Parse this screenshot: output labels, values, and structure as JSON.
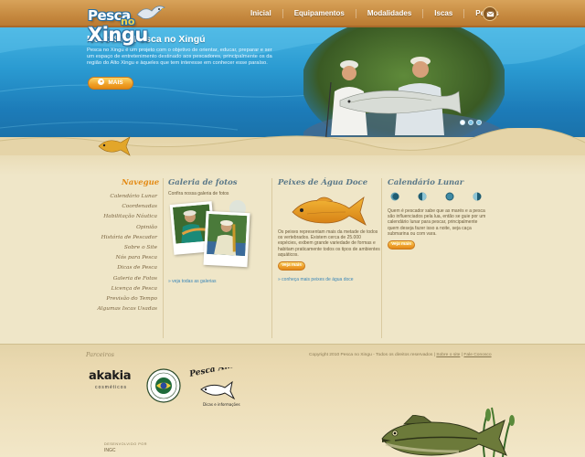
{
  "brand": {
    "logo_line1": "Pesca",
    "logo_line2": "no",
    "logo_line3": "Xingu"
  },
  "nav": {
    "items": [
      "Inicial",
      "Equipamentos",
      "Modalidades",
      "Iscas",
      "Peixes"
    ]
  },
  "hero": {
    "title": "Novo Site Pesca no Xingú",
    "text": "Pesca no Xingu é um projeto com o objetivo de orientar, educar, preparar e ser um espaço de entretenimento destinado aos pescadores, principalmente os da região do Alto Xingu e àqueles que tem interesse em conhecer esse paraíso.",
    "button_label": "MAIS",
    "slides_count": 3,
    "active_slide": 1
  },
  "sidebar": {
    "title": "Navegue",
    "items": [
      "Calendário Lunar",
      "Coordenadas",
      "Habilitação Náutica",
      "Opinião",
      "História de Pescador",
      "Sobre o Site",
      "Nós para Pesca",
      "Dicas de Pesca",
      "Galeria de Fotos",
      "Licença de Pesca",
      "Previsão do Tempo",
      "Algumas Iscas Usadas"
    ]
  },
  "gallery": {
    "title": "Galeria de fotos",
    "subtitle": "Confira nossa galeria de fotos",
    "link": "» veja todas as galerias"
  },
  "fish": {
    "title": "Peixes de Água Doce",
    "text": "Os peixes representam mais da metade de todos os vertebrados. Existem cerca de 25.000 espécies, exibem grande variedade de formas e habitam praticamente todos os tipos de ambientes aquáticos.",
    "button_label": "Veja mais",
    "link": "» conheça mais peixes de água doce"
  },
  "lunar": {
    "title": "Calendário Lunar",
    "text": "Quem é pescador sabe que as marés e a pesca são influenciados pela lua, então se guie por um calendário lunar para pescar, principalmente quem deseja fazer isso a noite, seja caça submarina ou com vara.",
    "button_label": "Veja mais"
  },
  "footer": {
    "partners_title": "Parceiros",
    "copyright": "Copyright 2010 Pesca no Xingu - Todos os direitos reservados |",
    "about_link": "Sobre o site",
    "contact_link": "Fale Conosco",
    "separator": "|",
    "partner1": "akakia",
    "partner1_sub": "cosméticos",
    "partner3": "Pesca Amadora",
    "partner3_sub": "Dicas e informações",
    "dev_label": "DESENVOLVIDO POR",
    "dev_name": "INGC"
  },
  "colors": {
    "accent": "#e38a14",
    "header_wood": "#c68a40",
    "hero_blue": "#2a9ad1",
    "title_blue": "#5a7888",
    "link_blue": "#3a86b8",
    "background": "#efe6c8"
  }
}
